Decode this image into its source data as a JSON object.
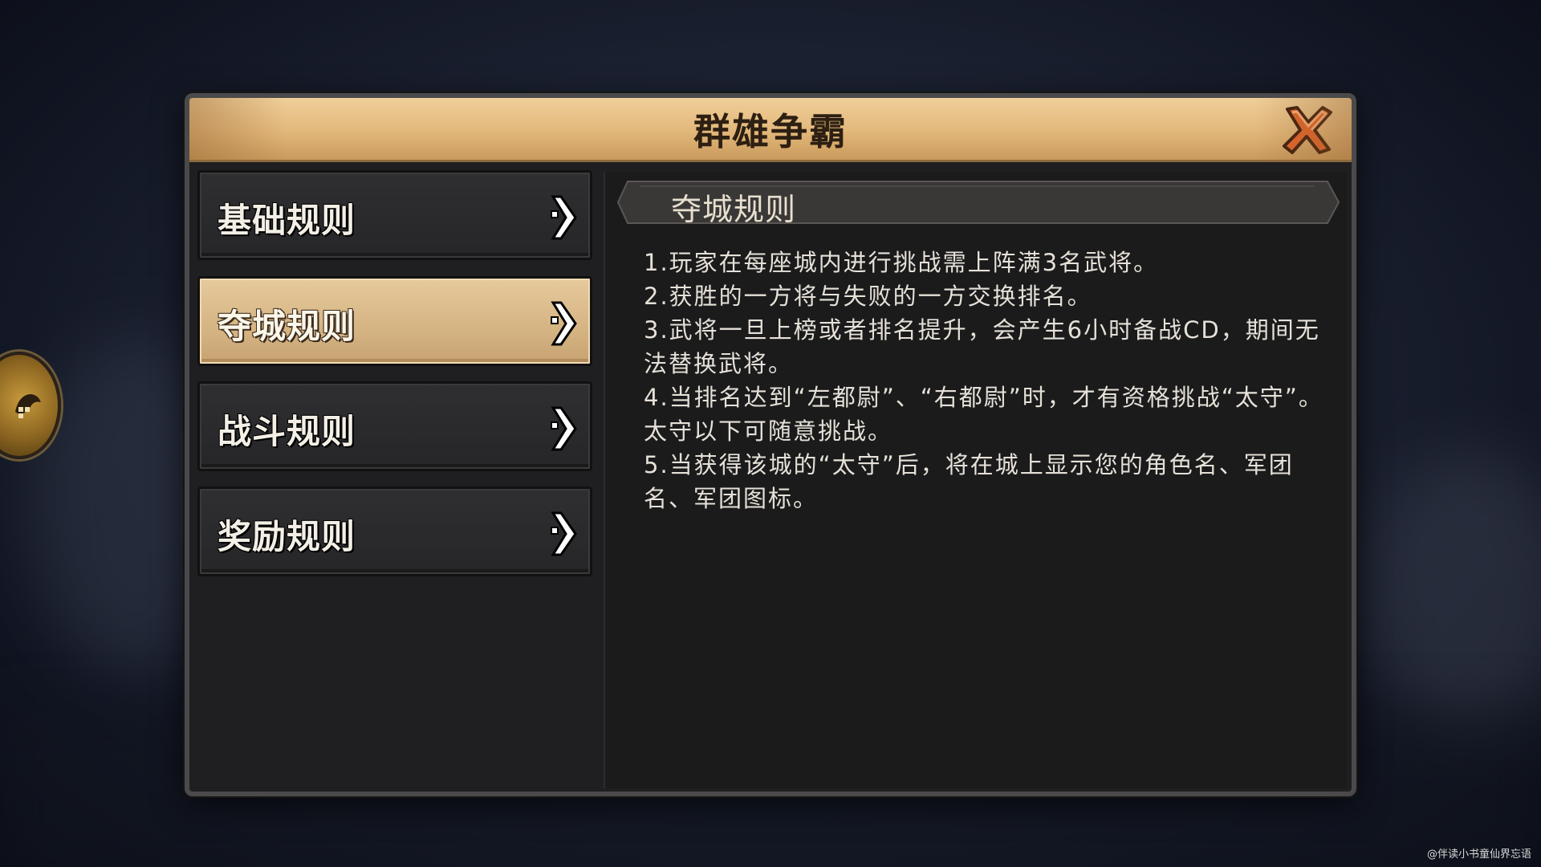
{
  "window": {
    "title": "群雄争霸"
  },
  "menu": {
    "items": [
      {
        "label": "基础规则",
        "active": false
      },
      {
        "label": "夺城规则",
        "active": true
      },
      {
        "label": "战斗规则",
        "active": false
      },
      {
        "label": "奖励规则",
        "active": false
      }
    ]
  },
  "content": {
    "header": "夺城规则",
    "rules": [
      "1.玩家在每座城内进行挑战需上阵满3名武将。",
      "2.获胜的一方将与失败的一方交换排名。",
      "3.武将一旦上榜或者排名提升，会产生6小时备战CD，期间无法替换武将。",
      "4.当排名达到“左都尉”、“右都尉”时，才有资格挑战“太守”。太守以下可随意挑战。",
      "5.当获得该城的“太守”后，将在城上显示您的角色名、军团名、军团图标。"
    ]
  },
  "icons": {
    "close": "close-x-icon",
    "arrow": "chevron-right-icon",
    "side": "emblem-icon"
  },
  "colors": {
    "title_bar": "#e2b77a",
    "active_tab": "#d5b483",
    "panel": "#1f1f21",
    "close_x": "#e2642a"
  },
  "watermark": "@伴读小书童仙界忘语"
}
